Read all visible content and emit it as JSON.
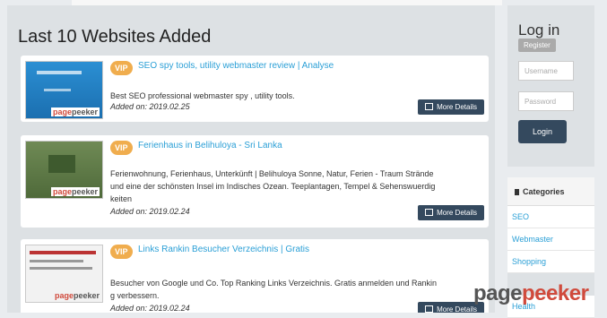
{
  "main": {
    "heading": "Last 10 Websites Added",
    "sites": [
      {
        "badge": "VIP",
        "title": "SEO spy tools, utility webmaster review | Analyse",
        "description": "Best SEO professional webmaster spy , utility tools.",
        "added": "Added on: 2019.02.25",
        "button": "More Details",
        "thumb_label": "pagepeeker"
      },
      {
        "badge": "VIP",
        "title": "Ferienhaus in Belihuloya - Sri Lanka",
        "description_lines": [
          "Ferienwohnung, Ferienhaus, Unterkünft | Belihuloya Sonne, Natur, Ferien - Traum Strände",
          "und eine der schönsten Insel im Indisches Ozean. Teeplantagen, Tempel & Sehenswuerdig",
          "keiten"
        ],
        "added": "Added on: 2019.02.24",
        "button": "More Details",
        "thumb_label": "pagepeeker"
      },
      {
        "badge": "VIP",
        "title": "Links Rankin Besucher Verzeichnis | Gratis",
        "description_lines": [
          "Besucher von Google und Co. Top Ranking Links Verzeichnis. Gratis anmelden und Rankin",
          "g verbessern."
        ],
        "added": "Added on: 2019.02.24",
        "button": "More Details",
        "thumb_label": "pagepeeker"
      }
    ]
  },
  "sidebar": {
    "login_title": "Log in",
    "register": "Register",
    "username_placeholder": "Username",
    "password_placeholder": "Password",
    "login_button": "Login",
    "categories_title": "Categories",
    "categories": [
      "SEO",
      "Webmaster",
      "Shopping",
      "Health"
    ]
  },
  "watermark": "pagepeeker",
  "colors": {
    "accent": "#2a9fd6",
    "vip": "#f0ad4e",
    "button": "#34495e"
  }
}
